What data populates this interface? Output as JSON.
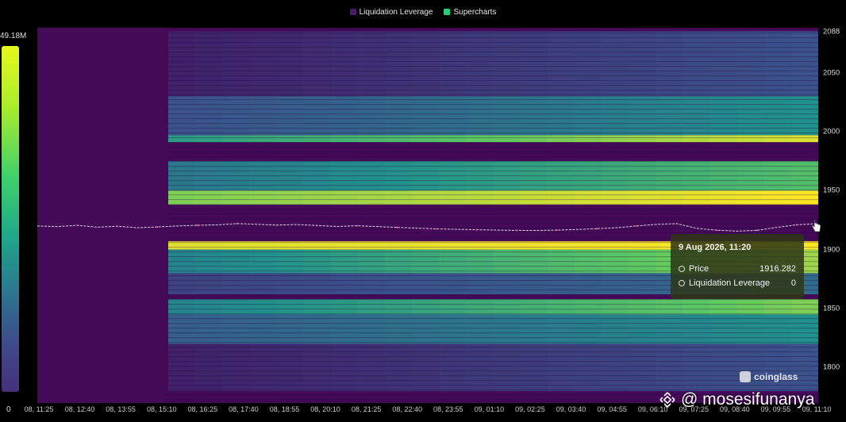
{
  "legend": [
    {
      "label": "Liquidation Leverage",
      "color": "#4b1a6a"
    },
    {
      "label": "Supercharts",
      "color": "#1ed07a"
    }
  ],
  "colorscale": {
    "max_label": "49.18M",
    "min_label": "0"
  },
  "chart_data": {
    "type": "heatmap",
    "x_ticks": [
      "08, 11:25",
      "08, 12:40",
      "08, 13:55",
      "08, 15:10",
      "08, 16:25",
      "08, 17:40",
      "08, 18:55",
      "08, 20:10",
      "08, 21:25",
      "08, 22:40",
      "08, 23:55",
      "09, 01:10",
      "09, 02:25",
      "09, 03:40",
      "09, 04:55",
      "09, 06:10",
      "09, 07:25",
      "09, 08:40",
      "09, 09:55",
      "09, 11:10"
    ],
    "y_ticks": [
      2088,
      2050,
      2000,
      1950,
      1900,
      1850,
      1800
    ],
    "ylim": [
      1770,
      2088
    ],
    "bands": [
      {
        "price_low": 1938,
        "price_high": 1950,
        "intensity_start": 0.8,
        "intensity_end": 1.0
      },
      {
        "price_low": 1950,
        "price_high": 1975,
        "intensity_start": 0.4,
        "intensity_end": 0.7
      },
      {
        "price_low": 1991,
        "price_high": 1997,
        "intensity_start": 0.55,
        "intensity_end": 0.95
      },
      {
        "price_low": 1997,
        "price_high": 2030,
        "intensity_start": 0.25,
        "intensity_end": 0.5
      },
      {
        "price_low": 2030,
        "price_high": 2085,
        "intensity_start": 0.1,
        "intensity_end": 0.25
      },
      {
        "price_low": 1900,
        "price_high": 1907,
        "intensity_start": 0.95,
        "intensity_end": 1.0
      },
      {
        "price_low": 1880,
        "price_high": 1900,
        "intensity_start": 0.45,
        "intensity_end": 0.85
      },
      {
        "price_low": 1862,
        "price_high": 1880,
        "intensity_start": 0.2,
        "intensity_end": 0.35
      },
      {
        "price_low": 1845,
        "price_high": 1858,
        "intensity_start": 0.45,
        "intensity_end": 0.8
      },
      {
        "price_low": 1820,
        "price_high": 1845,
        "intensity_start": 0.3,
        "intensity_end": 0.5
      },
      {
        "price_low": 1780,
        "price_high": 1820,
        "intensity_start": 0.1,
        "intensity_end": 0.25
      }
    ],
    "price_series": [
      1920,
      1919.5,
      1920.5,
      1919,
      1919.8,
      1918.5,
      1919.2,
      1920,
      1920.6,
      1921,
      1922,
      1921.5,
      1920.8,
      1921.3,
      1920.4,
      1919.6,
      1920.2,
      1919.5,
      1918.8,
      1918.2,
      1917.6,
      1917.2,
      1916.8,
      1916.5,
      1916.3,
      1916.2,
      1916.5,
      1917,
      1917.8,
      1918.5,
      1920,
      1921.5,
      1922,
      1918,
      1916.5,
      1915.6,
      1916.3,
      1918.8,
      1921,
      1922
    ]
  },
  "tooltip": {
    "title": "9 Aug 2026, 11:20",
    "rows": [
      {
        "label": "Price",
        "value": "1916.282"
      },
      {
        "label": "Liquidation Leverage",
        "value": "0"
      }
    ]
  },
  "watermark": {
    "brand": "coinglass",
    "user": "@ mosesifunanya"
  },
  "icons": {
    "brand": "coinglass-logo-icon",
    "user": "binance-logo-icon",
    "cursor": "hand-pointer-icon"
  }
}
